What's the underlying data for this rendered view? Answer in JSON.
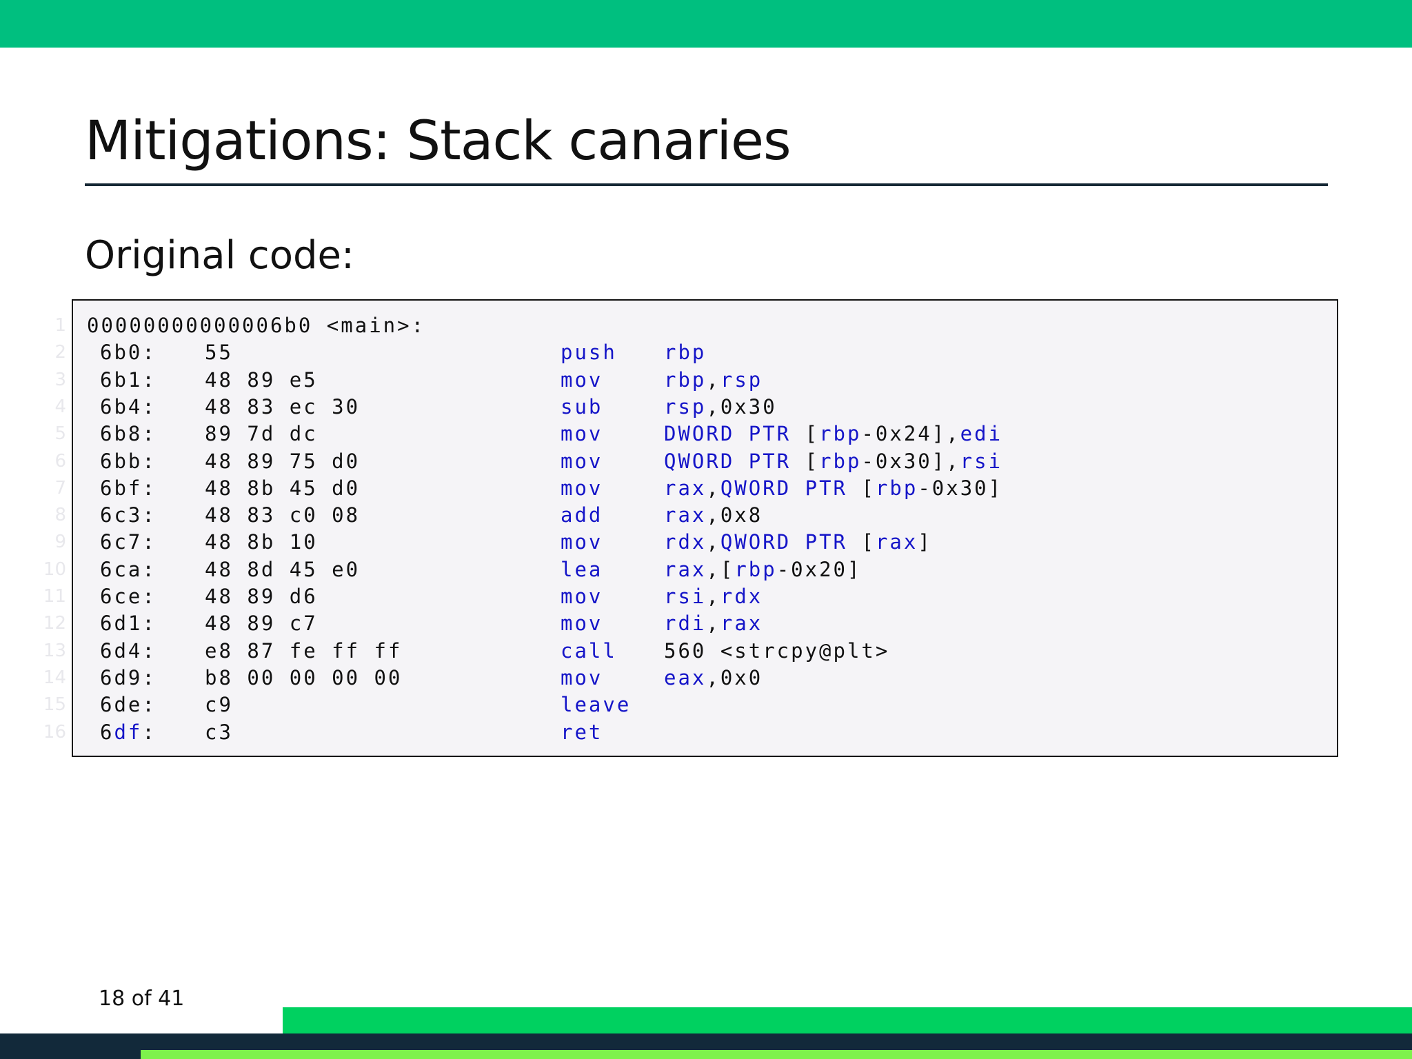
{
  "slide": {
    "title": "Mitigations: Stack canaries",
    "subtitle": "Original code:",
    "page_indicator": "18 of 41"
  },
  "colors": {
    "top_bar": "#00bf7f",
    "keyword": "#1515c8",
    "code_background": "#f5f4f7",
    "footer_green": "#00d160",
    "footer_dark": "#12293a",
    "footer_lime": "#7ef24c"
  },
  "code": {
    "header": "00000000000006b0 <main>:",
    "lines": [
      {
        "num": "1"
      },
      {
        "num": "2",
        "addr": "6b0:",
        "bytes": "55",
        "op": "push",
        "args": [
          {
            "t": "rbp",
            "k": true
          }
        ]
      },
      {
        "num": "3",
        "addr": "6b1:",
        "bytes": "48 89 e5",
        "op": "mov",
        "args": [
          {
            "t": "rbp",
            "k": true
          },
          {
            "t": ","
          },
          {
            "t": "rsp",
            "k": true
          }
        ]
      },
      {
        "num": "4",
        "addr": "6b4:",
        "bytes": "48 83 ec 30",
        "op": "sub",
        "args": [
          {
            "t": "rsp",
            "k": true
          },
          {
            "t": ",0x30"
          }
        ]
      },
      {
        "num": "5",
        "addr": "6b8:",
        "bytes": "89 7d dc",
        "op": "mov",
        "args": [
          {
            "t": "DWORD PTR",
            "k": true
          },
          {
            "t": " ["
          },
          {
            "t": "rbp",
            "k": true
          },
          {
            "t": "-0x24],"
          },
          {
            "t": "edi",
            "k": true
          }
        ]
      },
      {
        "num": "6",
        "addr": "6bb:",
        "bytes": "48 89 75 d0",
        "op": "mov",
        "args": [
          {
            "t": "QWORD PTR",
            "k": true
          },
          {
            "t": " ["
          },
          {
            "t": "rbp",
            "k": true
          },
          {
            "t": "-0x30],"
          },
          {
            "t": "rsi",
            "k": true
          }
        ]
      },
      {
        "num": "7",
        "addr": "6bf:",
        "bytes": "48 8b 45 d0",
        "op": "mov",
        "args": [
          {
            "t": "rax",
            "k": true
          },
          {
            "t": ","
          },
          {
            "t": "QWORD PTR",
            "k": true
          },
          {
            "t": " ["
          },
          {
            "t": "rbp",
            "k": true
          },
          {
            "t": "-0x30]"
          }
        ]
      },
      {
        "num": "8",
        "addr": "6c3:",
        "bytes": "48 83 c0 08",
        "op": "add",
        "args": [
          {
            "t": "rax",
            "k": true
          },
          {
            "t": ",0x8"
          }
        ]
      },
      {
        "num": "9",
        "addr": "6c7:",
        "bytes": "48 8b 10",
        "op": "mov",
        "args": [
          {
            "t": "rdx",
            "k": true
          },
          {
            "t": ","
          },
          {
            "t": "QWORD PTR",
            "k": true
          },
          {
            "t": " ["
          },
          {
            "t": "rax",
            "k": true
          },
          {
            "t": "]"
          }
        ]
      },
      {
        "num": "10",
        "addr": "6ca:",
        "bytes": "48 8d 45 e0",
        "op": "lea",
        "args": [
          {
            "t": "rax",
            "k": true
          },
          {
            "t": ",["
          },
          {
            "t": "rbp",
            "k": true
          },
          {
            "t": "-0x20]"
          }
        ]
      },
      {
        "num": "11",
        "addr": "6ce:",
        "bytes": "48 89 d6",
        "op": "mov",
        "args": [
          {
            "t": "rsi",
            "k": true
          },
          {
            "t": ","
          },
          {
            "t": "rdx",
            "k": true
          }
        ]
      },
      {
        "num": "12",
        "addr": "6d1:",
        "bytes": "48 89 c7",
        "op": "mov",
        "args": [
          {
            "t": "rdi",
            "k": true
          },
          {
            "t": ","
          },
          {
            "t": "rax",
            "k": true
          }
        ]
      },
      {
        "num": "13",
        "addr": "6d4:",
        "bytes": "e8 87 fe ff ff",
        "op": "call",
        "args": [
          {
            "t": "560 <strcpy@plt>"
          }
        ]
      },
      {
        "num": "14",
        "addr": "6d9:",
        "bytes": "b8 00 00 00 00",
        "op": "mov",
        "args": [
          {
            "t": "eax",
            "k": true
          },
          {
            "t": ",0x0"
          }
        ]
      },
      {
        "num": "15",
        "addr": "6de:",
        "bytes": "c9",
        "op": "leave",
        "args": []
      },
      {
        "num": "16",
        "addr_parts": [
          {
            "t": "6"
          },
          {
            "t": "df",
            "k": true
          },
          {
            "t": ":"
          }
        ],
        "bytes": "c3",
        "op": "ret",
        "args": []
      }
    ]
  }
}
